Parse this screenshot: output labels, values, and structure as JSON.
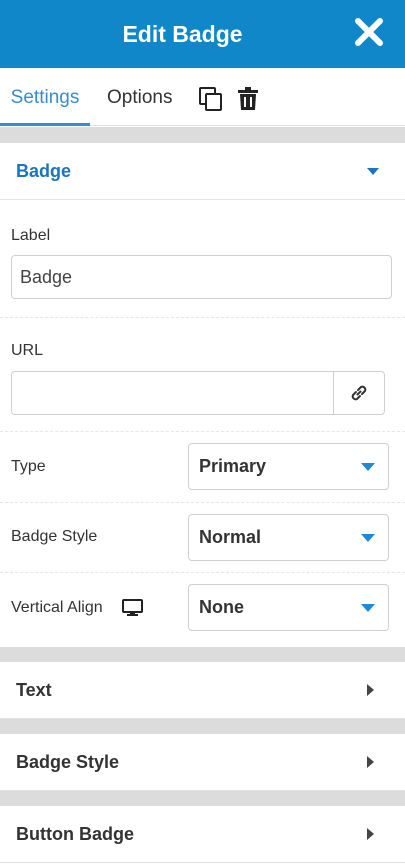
{
  "header": {
    "title": "Edit Badge"
  },
  "tabs": {
    "settings": "Settings",
    "options": "Options"
  },
  "sections": {
    "badge": "Badge",
    "text": "Text",
    "badge_style": "Badge Style",
    "button_badge": "Button Badge"
  },
  "fields": {
    "label": {
      "label": "Label",
      "value": "Badge"
    },
    "url": {
      "label": "URL",
      "value": ""
    },
    "type": {
      "label": "Type",
      "value": "Primary"
    },
    "badge_style": {
      "label": "Badge Style",
      "value": "Normal"
    },
    "vertical_align": {
      "label": "Vertical Align",
      "value": "None"
    }
  },
  "colors": {
    "header": "#0f87c9",
    "accent": "#3a8bd1"
  }
}
